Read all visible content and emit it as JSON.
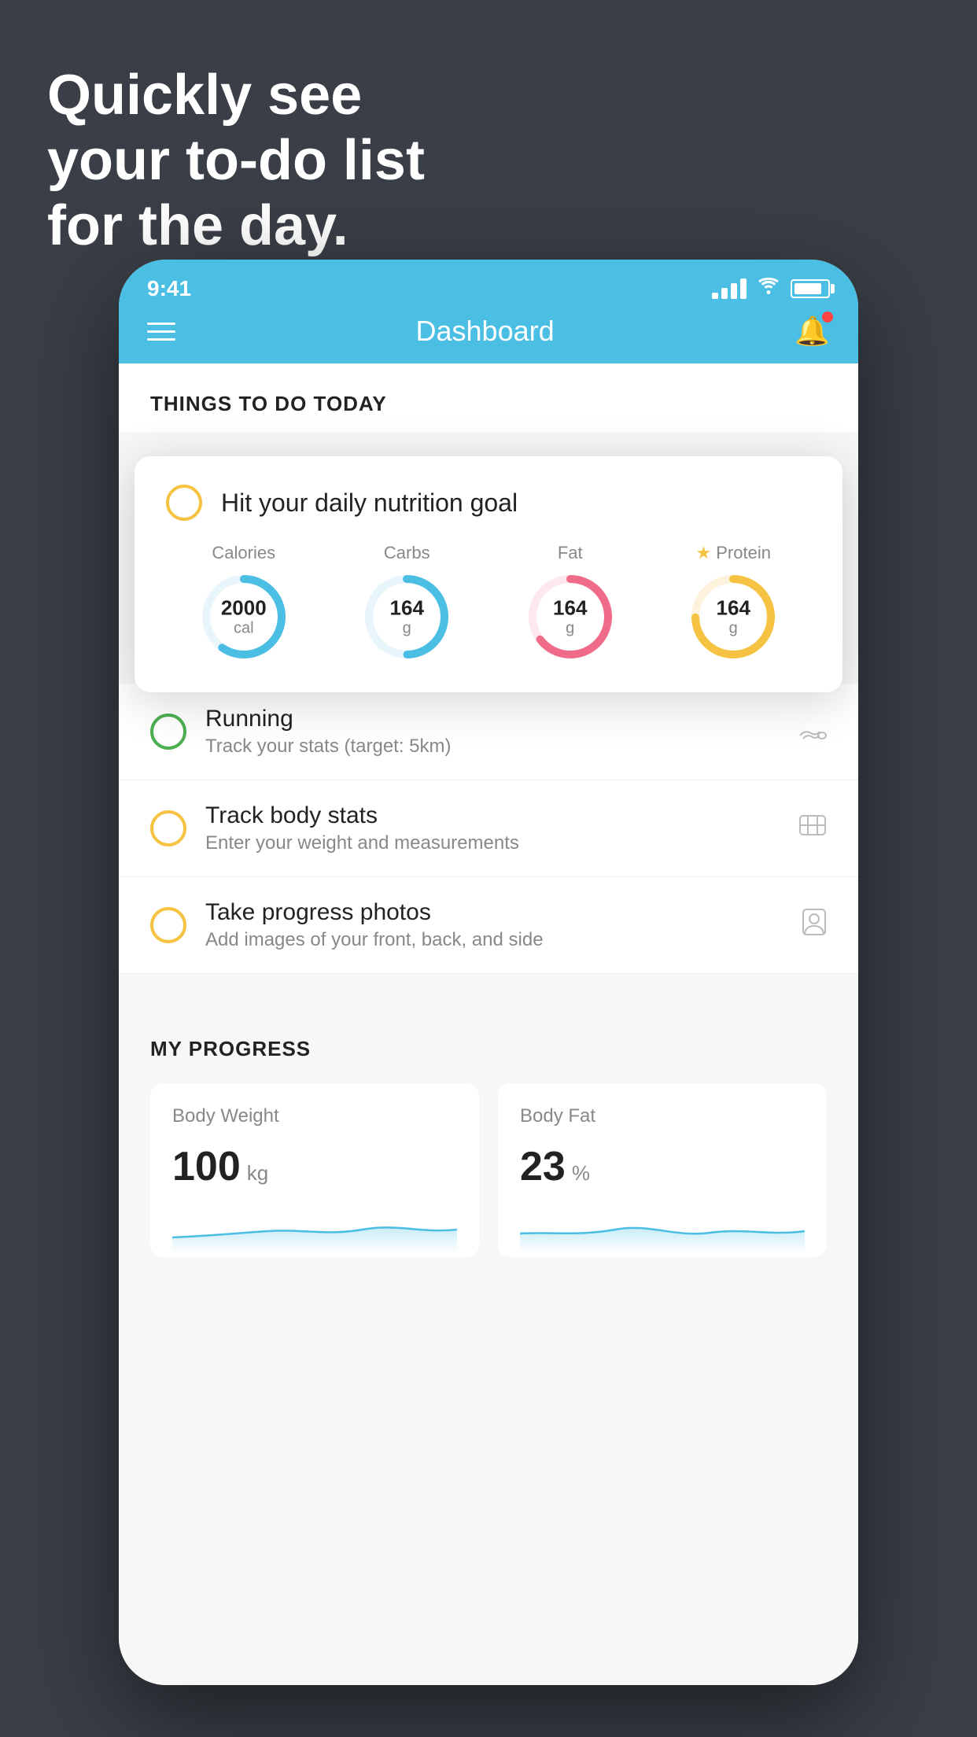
{
  "background_color": "#3a3f47",
  "hero": {
    "text": "Quickly see\nyour to-do list\nfor the day."
  },
  "phone": {
    "status_bar": {
      "time": "9:41",
      "signal_bars": 4,
      "wifi": true,
      "battery_percent": 85
    },
    "nav_bar": {
      "title": "Dashboard",
      "hamburger_label": "menu",
      "bell_label": "notifications",
      "bell_has_dot": true
    },
    "things_section": {
      "title": "THINGS TO DO TODAY"
    },
    "featured_card": {
      "circle_color": "#f5c242",
      "title": "Hit your daily nutrition goal",
      "nutrition_items": [
        {
          "label": "Calories",
          "value": "2000",
          "unit": "cal",
          "color": "#4bbee3",
          "percent": 60,
          "star": false
        },
        {
          "label": "Carbs",
          "value": "164",
          "unit": "g",
          "color": "#4bbee3",
          "percent": 50,
          "star": false
        },
        {
          "label": "Fat",
          "value": "164",
          "unit": "g",
          "color": "#f06b8a",
          "percent": 65,
          "star": false
        },
        {
          "label": "Protein",
          "value": "164",
          "unit": "g",
          "color": "#f5c242",
          "percent": 75,
          "star": true
        }
      ]
    },
    "list_items": [
      {
        "circle_color": "green",
        "title": "Running",
        "subtitle": "Track your stats (target: 5km)",
        "icon": "shoe"
      },
      {
        "circle_color": "yellow",
        "title": "Track body stats",
        "subtitle": "Enter your weight and measurements",
        "icon": "scale"
      },
      {
        "circle_color": "yellow",
        "title": "Take progress photos",
        "subtitle": "Add images of your front, back, and side",
        "icon": "person"
      }
    ],
    "progress_section": {
      "title": "MY PROGRESS",
      "cards": [
        {
          "label": "Body Weight",
          "value": "100",
          "unit": "kg",
          "sparkline_color": "#4bbee3"
        },
        {
          "label": "Body Fat",
          "value": "23",
          "unit": "%",
          "sparkline_color": "#4bbee3"
        }
      ]
    }
  }
}
